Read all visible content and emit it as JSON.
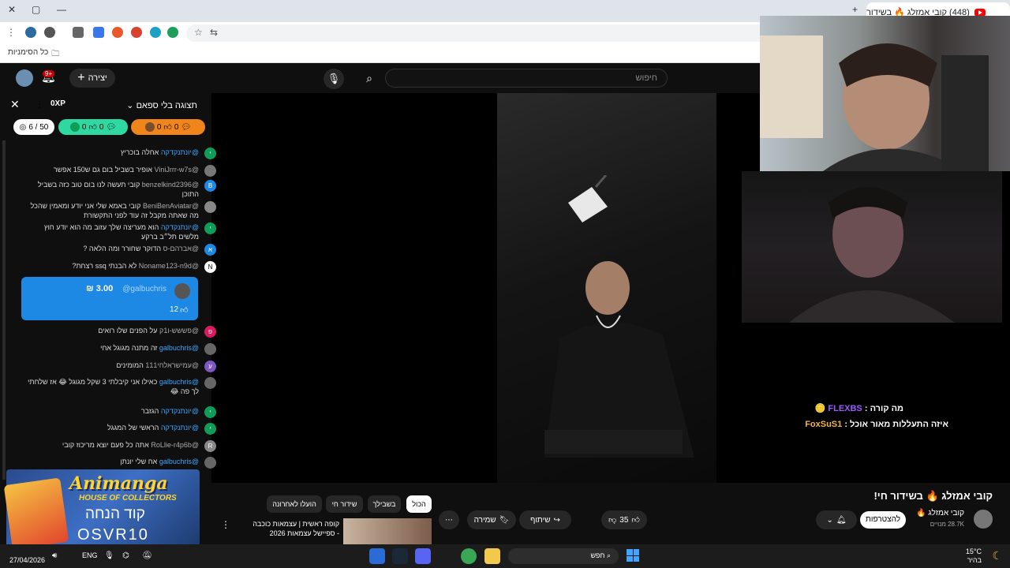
{
  "browser": {
    "tab_title": "(448) קובי אמזלג 🔥 בשידור",
    "bookmarks_folder": "כל הסימניות"
  },
  "youtube": {
    "search_placeholder": "חיפוש",
    "create_label": "יצירה",
    "notifications_badge": "9+"
  },
  "chat": {
    "mode_label": "תצוגה בלי ספאם",
    "xp_badge": "0XP",
    "stats": {
      "rank": "6 / 50",
      "green_likes": "0",
      "green_comments": "0",
      "orange_likes": "0",
      "orange_comments": "0"
    },
    "messages": [
      {
        "user": "@יונתנקדקה",
        "text": "אחלה בוכריץ",
        "user_color": "blue",
        "avatar": "י",
        "avatar_color": "#0f9d58"
      },
      {
        "user": "@ViniJrrr-w7s",
        "text": "אופיר בשביל בום גם ש150 אפשר",
        "user_color": "gray",
        "avatar": "",
        "avatar_color": "#777"
      },
      {
        "user": "@benzelkind2396",
        "text": "קובי תעשה לנו בום טוב כזה בשביל התוכן",
        "user_color": "gray",
        "avatar": "B",
        "avatar_color": "#1e88e5"
      },
      {
        "user": "@BeniBenAviatar",
        "text": "קובי באמא שלי אני יודע ומאמין שהכל מה שאתה מקבל זה עוד לפני התקשורת",
        "user_color": "gray",
        "avatar": "",
        "avatar_color": "#888"
      },
      {
        "user": "@יונתנקדקה",
        "text": "הוא מעריצה שלך עזוב מה הוא יודע חוץ מלשים תל״ב ברקע",
        "user_color": "blue",
        "avatar": "י",
        "avatar_color": "#0f9d58"
      },
      {
        "user": "@אברהם-ס",
        "text": "הדוקר שחורר ומה הלאה ?",
        "user_color": "gray",
        "avatar": "א",
        "avatar_color": "#1e88e5"
      },
      {
        "user": "@Noname123-n9d",
        "text": "לא הבנתי ssq רצחת?",
        "user_color": "gray",
        "avatar": "N",
        "avatar_color": "#fff"
      }
    ],
    "superchat": {
      "user": "@galbuchris",
      "amount": "₪ 3.00",
      "likes": "12"
    },
    "messages2": [
      {
        "user": "@פששש-ו1ק",
        "text": "על הפנים שלו רואים",
        "user_color": "gray",
        "avatar": "פ",
        "avatar_color": "#d81b60"
      },
      {
        "user": "@galbuchris",
        "text": "זה מתנה מגוגל אחי",
        "user_color": "blue",
        "avatar": "",
        "avatar_color": "#666"
      },
      {
        "user": "@עמישראלחי111",
        "text": "המומינים",
        "user_color": "gray",
        "avatar": "ע",
        "avatar_color": "#7e57c2"
      },
      {
        "user": "@galbuchris",
        "text": "כאילו אני קיבלתי 3 שקל מגוגל 😂 אז שלחתי לך פה 😂",
        "user_color": "blue",
        "avatar": "",
        "avatar_color": "#666"
      },
      {
        "user": "@יונתנקדקה",
        "text": "הגזבר",
        "user_color": "blue",
        "avatar": "י",
        "avatar_color": "#0f9d58"
      },
      {
        "user": "@יונתנקדקה",
        "text": "הראשי של המגגל",
        "user_color": "blue",
        "avatar": "י",
        "avatar_color": "#0f9d58"
      },
      {
        "user": "@RoLlie-r4p6b",
        "text": "אתה כל פעם יוצא מריכוז קובי",
        "user_color": "gray",
        "avatar": "R",
        "avatar_color": "#888"
      },
      {
        "user": "@galbuchris",
        "text": "אח שלי יונתן",
        "user_color": "blue",
        "avatar": "",
        "avatar_color": "#666"
      }
    ]
  },
  "overlay": {
    "line1_prefix": "מה קורה :",
    "line1_name": "FLEXBS",
    "line2_text": "איזה התעללות מאור אוכל :",
    "line2_name": "FoxSuS1"
  },
  "video_info": {
    "title": "קובי אמזלג 🔥 בשידור חי!",
    "channel": "קובי אמזלג 🔥",
    "subscribers": "28.7K מנויים",
    "join_label": "להצטרפות",
    "likes": "35",
    "share_label": "שיתוף",
    "save_label": "שמירה"
  },
  "chips": [
    "הכול",
    "בשבילך",
    "שידור חי",
    "הועלו לאחרונה"
  ],
  "recommended": {
    "title": "קופה ראשית | עצמאות כוכבה - ספיישל עצמאות 2026"
  },
  "promo": {
    "brand": "Animanga",
    "sub": "HOUSE OF COLLECTORS",
    "code_label": "קוד הנחה",
    "code": "OSVR10"
  },
  "taskbar": {
    "date": "27/04/2026",
    "language": "ENG",
    "search_label": "חפש",
    "temp": "15°C",
    "weather": "בהיר"
  }
}
